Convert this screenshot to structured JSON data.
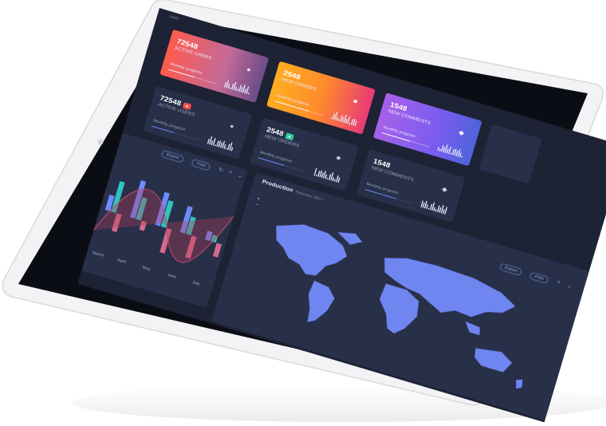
{
  "screen_label": "reals",
  "cards": [
    {
      "value": "72548",
      "label": "ACTIVE USERS",
      "sub": "Monthly progress",
      "progress": 0.55,
      "icon": "users-icon"
    },
    {
      "value": "2548",
      "label": "NEW ORDERS",
      "sub": "Monthly progress",
      "progress": 0.7,
      "icon": "cart-icon"
    },
    {
      "value": "1548",
      "label": "NEW COMMENTS",
      "sub": "Monthly progress",
      "progress": 0.6,
      "icon": "comment-icon"
    }
  ],
  "tiles": [
    {
      "value": "72548",
      "badge": "",
      "label": "ACTIVE USERS",
      "sub": "Monthly progress",
      "progress": 0.45,
      "icon": "users-icon"
    },
    {
      "value": "2548",
      "badge": "",
      "label": "NEW ORDERS",
      "sub": "Monthly progress",
      "progress": 0.55,
      "icon": "cart-icon"
    },
    {
      "value": "1548",
      "label": "NEW COMMENTS",
      "sub": "Monthly progress",
      "progress": 0.65,
      "icon": "comment-icon"
    }
  ],
  "colors": {
    "badge_red": "#ff4b4b",
    "badge_green": "#2ecc9a",
    "accent_blue": "#6c8cff"
  },
  "left_panel": {
    "export": "Export",
    "print": "Print"
  },
  "chart_data": {
    "type": "bar",
    "categories": [
      "March",
      "April",
      "May",
      "June",
      "July"
    ],
    "series": [
      {
        "values": [
          0.35,
          0.85,
          0.75,
          0.6,
          0.2
        ]
      },
      {
        "values": [
          0.7,
          0.5,
          0.6,
          0.4,
          0.15
        ]
      },
      {
        "values": [
          -0.4,
          -0.2,
          -0.55,
          -0.5,
          -0.3
        ]
      }
    ],
    "xlabel": "",
    "ylabel": ""
  },
  "production": {
    "title": "Production",
    "subtitle": "February 2017",
    "export": "Export",
    "print": "Print"
  }
}
